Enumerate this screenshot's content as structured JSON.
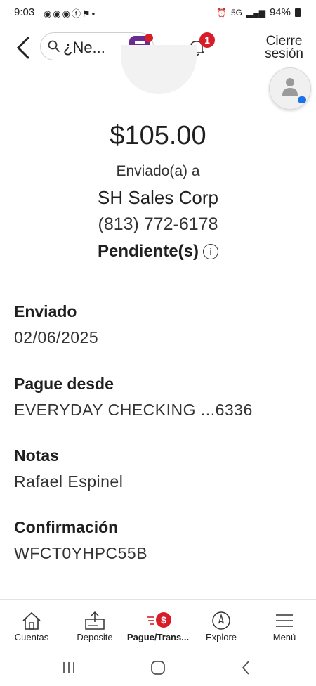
{
  "status_bar": {
    "time": "9:03",
    "left_icons": "◉◉◉ⓕ⚑•",
    "network": "5G",
    "battery": "94%"
  },
  "header": {
    "search_text": "¿Ne...",
    "notification_count": "1",
    "logout_label_line1": "Cierre",
    "logout_label_line2": "sesión"
  },
  "summary": {
    "amount": "$105.00",
    "sent_to_label": "Enviado(a) a",
    "payee_name": "SH Sales Corp",
    "payee_phone": "(813) 772-6178",
    "status": "Pendiente(s)"
  },
  "details": [
    {
      "label": "Enviado",
      "value": "02/06/2025"
    },
    {
      "label": "Pague desde",
      "value": "EVERYDAY CHECKING ...6336"
    },
    {
      "label": "Notas",
      "value": "Rafael Espinel"
    },
    {
      "label": "Confirmación",
      "value": "WFCT0YHPC55B"
    }
  ],
  "bottom_nav": {
    "items": [
      {
        "label": "Cuentas",
        "icon": "home-icon"
      },
      {
        "label": "Deposite",
        "icon": "deposit-icon"
      },
      {
        "label": "Pague/Trans...",
        "icon": "pay-transfer-icon",
        "active": true
      },
      {
        "label": "Explore",
        "icon": "compass-icon"
      },
      {
        "label": "Menú",
        "icon": "hamburger-menu-icon"
      }
    ]
  },
  "colors": {
    "accent_red": "#d71e28",
    "fargo_purple": "#6a2c91"
  }
}
